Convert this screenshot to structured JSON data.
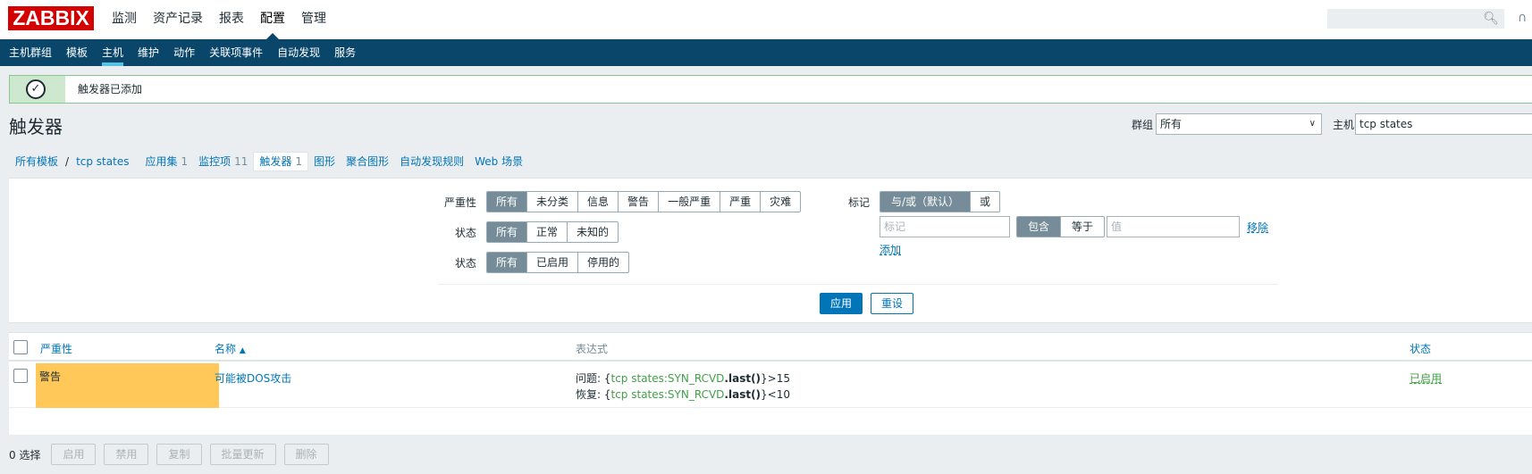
{
  "logo": "ZABBIX",
  "main_menu": [
    "监测",
    "资产记录",
    "报表",
    "配置",
    "管理"
  ],
  "main_menu_active": "配置",
  "sub_menu": [
    "主机群组",
    "模板",
    "主机",
    "维护",
    "动作",
    "关联项事件",
    "自动发现",
    "服务"
  ],
  "sub_menu_active": "主机",
  "icons": {
    "search": "search-icon",
    "help": "help-icon",
    "ok": "check-icon",
    "sort": "sort-asc-icon",
    "dropdown": "chevron-down-icon"
  },
  "message": {
    "text": "触发器已添加"
  },
  "page_title": "触发器",
  "header_filters": {
    "group_label": "群组",
    "group_value": "所有",
    "host_label": "主机",
    "host_value": "tcp states"
  },
  "breadcrumb": {
    "all_templates": "所有模板",
    "separator": "/",
    "host": "tcp states",
    "tabs": [
      {
        "label": "应用集",
        "count": "1"
      },
      {
        "label": "监控项",
        "count": "11"
      },
      {
        "label": "触发器",
        "count": "1",
        "selected": true
      },
      {
        "label": "图形",
        "count": ""
      },
      {
        "label": "聚合图形",
        "count": ""
      },
      {
        "label": "自动发现规则",
        "count": ""
      },
      {
        "label": "Web 场景",
        "count": ""
      }
    ]
  },
  "filter": {
    "severity_label": "严重性",
    "severity_options": [
      "所有",
      "未分类",
      "信息",
      "警告",
      "一般严重",
      "严重",
      "灾难"
    ],
    "state_label": "状态",
    "state_options": [
      "所有",
      "正常",
      "未知的"
    ],
    "status_label": "状态",
    "status_options": [
      "所有",
      "已启用",
      "停用的"
    ],
    "tags_label": "标记",
    "tags_operator_options": [
      "与/或（默认）",
      "或"
    ],
    "tag_placeholder": "标记",
    "tag_match_options": [
      "包含",
      "等于"
    ],
    "value_placeholder": "值",
    "remove_link": "移除",
    "add_link": "添加",
    "apply_button": "应用",
    "reset_button": "重设"
  },
  "table": {
    "headers": {
      "severity": "严重性",
      "name": "名称",
      "sort_arrow": "▲",
      "expression": "表达式",
      "status": "状态"
    },
    "rows": [
      {
        "severity": "警告",
        "name": "可能被DOS攻击",
        "problem_prefix": "问题: {",
        "problem_item": "tcp states:SYN_RCVD",
        "problem_func": ".last()",
        "problem_suffix": "}>15",
        "recovery_prefix": "恢复: {",
        "recovery_item": "tcp states:SYN_RCVD",
        "recovery_func": ".last()",
        "recovery_suffix": "}<10",
        "status": "已启用"
      }
    ]
  },
  "footer": {
    "selected_count": "0 选择",
    "buttons": [
      "启用",
      "禁用",
      "复制",
      "批量更新",
      "删除"
    ]
  },
  "colors": {
    "header_dark": "#0a466a",
    "accent": "#0275b8",
    "severity_warning": "#ffc859",
    "enabled_green": "#429e47",
    "logo_red": "#d40000"
  }
}
